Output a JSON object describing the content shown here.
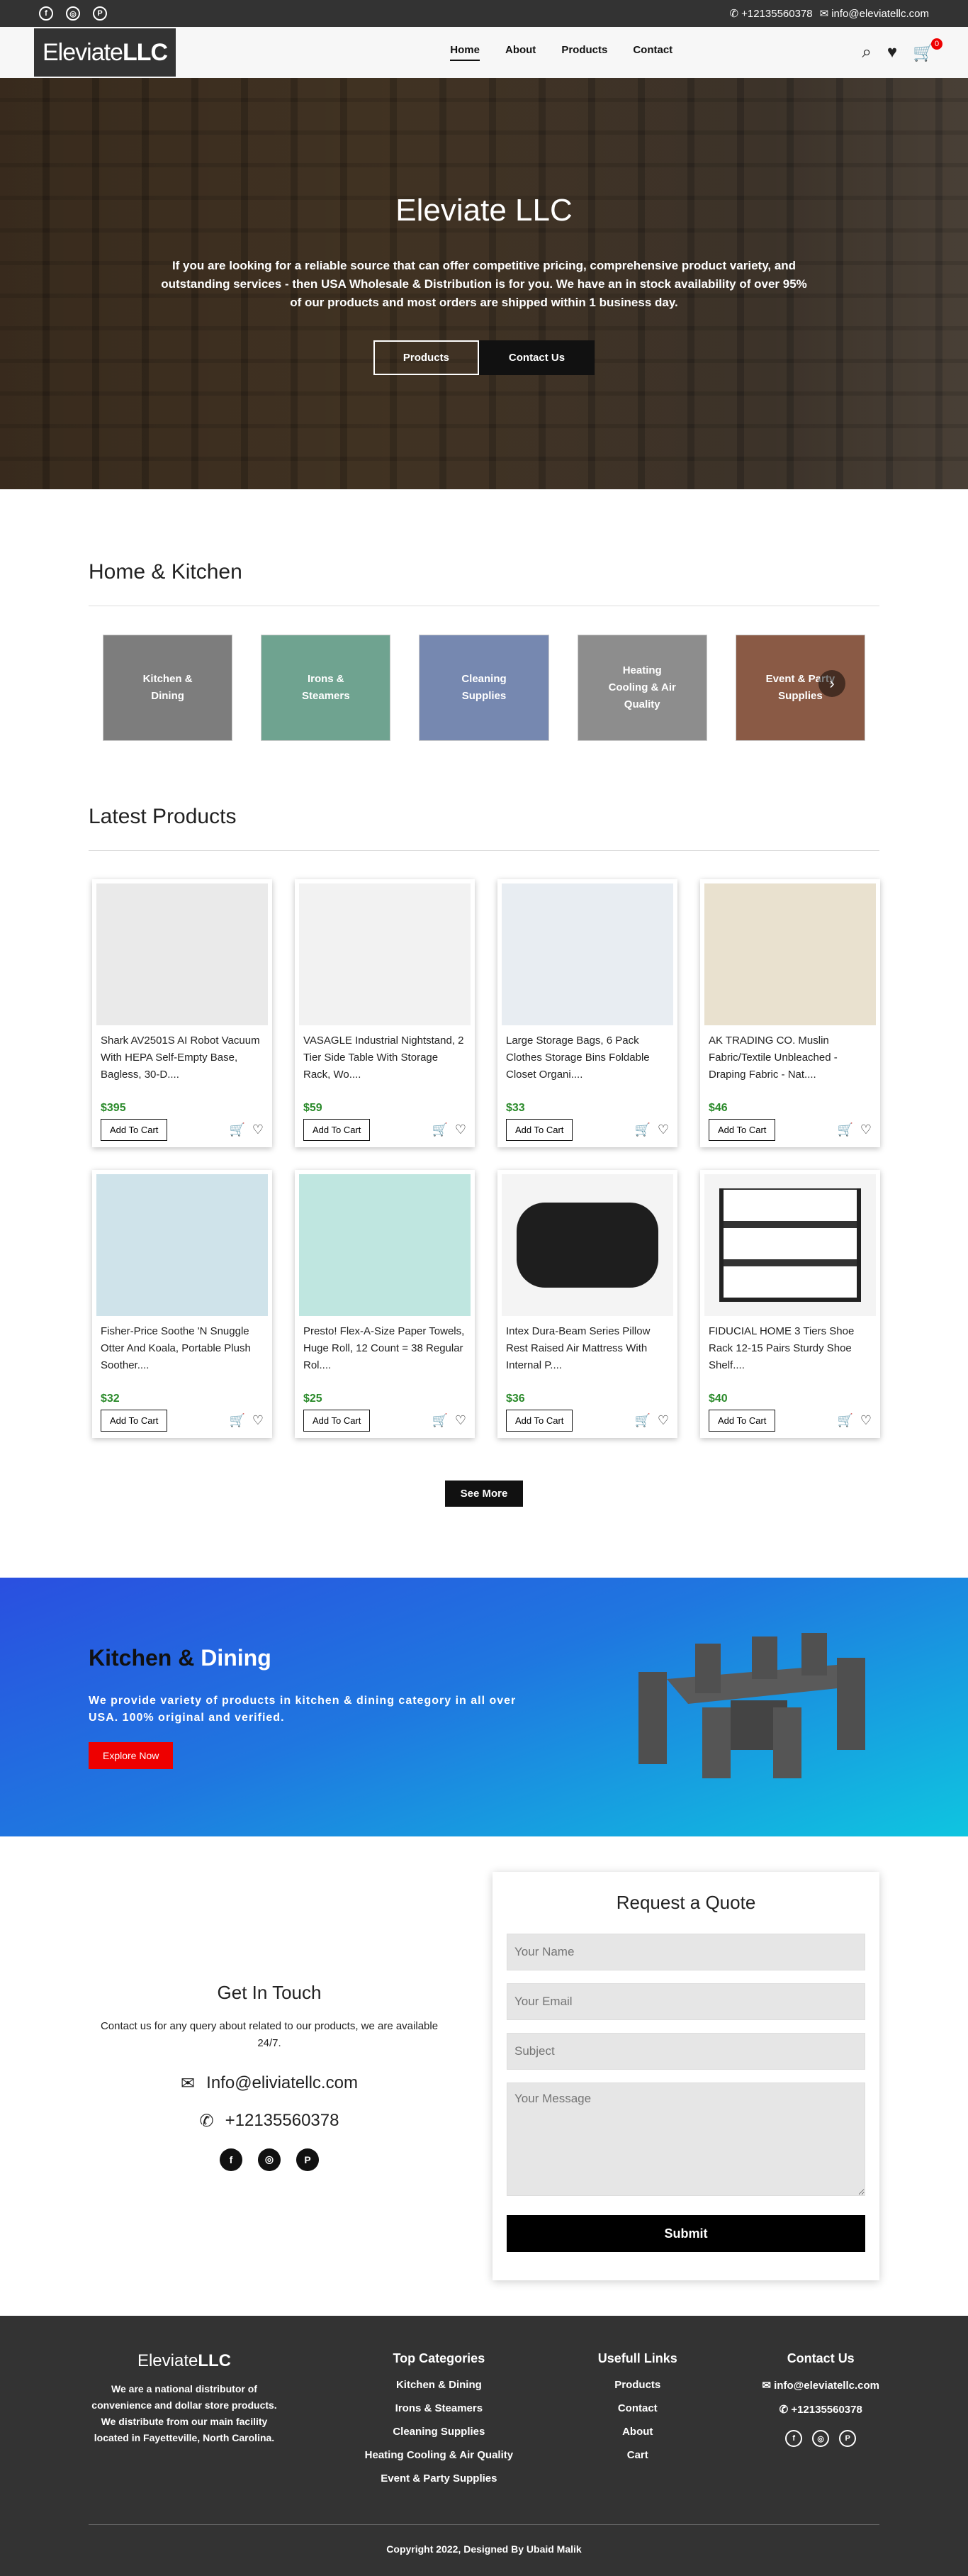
{
  "topbar": {
    "social_icons": [
      "facebook-icon",
      "instagram-icon",
      "pinterest-icon"
    ],
    "phone": "+12135560378",
    "email": "info@eleviatellc.com"
  },
  "nav": {
    "logo_main": "Eleviate",
    "logo_suffix": "LLC",
    "items": [
      "Home",
      "About",
      "Products",
      "Contact"
    ],
    "active": "Home",
    "cart_count": "0"
  },
  "hero": {
    "title": "Eleviate LLC",
    "text": "If you are looking for a reliable source that can offer competitive pricing, comprehensive product variety, and outstanding services - then USA Wholesale & Distribution is for you. We have an in stock availability of over 95% of our products and most orders are shipped within 1 business day.",
    "btn_products": "Products",
    "btn_contact": "Contact Us"
  },
  "categories": {
    "title": "Home & Kitchen",
    "items": [
      {
        "label": "Kitchen & Dining",
        "color": "#7d7d7d"
      },
      {
        "label": "Irons & Steamers",
        "color": "#6fa390"
      },
      {
        "label": "Cleaning Supplies",
        "color": "#7688b0"
      },
      {
        "label": "Heating Cooling & Air Quality",
        "color": "#8d8d8d"
      },
      {
        "label": "Event & Party Supplies",
        "color": "#8a5a45"
      }
    ]
  },
  "products": {
    "title": "Latest Products",
    "add_label": "Add To Cart",
    "items": [
      {
        "name": "Shark AV2501S AI Robot Vacuum With HEPA Self-Empty Base, Bagless, 30-D....",
        "price": "$395",
        "img": "#eaeaea"
      },
      {
        "name": "VASAGLE Industrial Nightstand, 2 Tier Side Table With Storage Rack, Wo....",
        "price": "$59",
        "img": "#f2f2f2"
      },
      {
        "name": "Large Storage Bags, 6 Pack Clothes Storage Bins Foldable Closet Organi....",
        "price": "$33",
        "img": "#e8edf2"
      },
      {
        "name": "AK TRADING CO. Muslin Fabric/Textile Unbleached - Draping Fabric - Nat....",
        "price": "$46",
        "img": "#e9e1cf"
      },
      {
        "name": "Fisher-Price Soothe 'N Snuggle Otter And Koala, Portable Plush Soother....",
        "price": "$32",
        "img": "#cfe3ea"
      },
      {
        "name": "Presto! Flex-A-Size Paper Towels, Huge Roll, 12 Count = 38 Regular Rol....",
        "price": "$25",
        "img": "#bfe6e0"
      },
      {
        "name": "Intex Dura-Beam Series Pillow Rest Raised Air Mattress With Internal P....",
        "price": "$36",
        "img": "#f4f4f4"
      },
      {
        "name": "FIDUCIAL HOME 3 Tiers Shoe Rack 12-15 Pairs Sturdy Shoe Shelf....",
        "price": "$40",
        "img": "#f4f4f4"
      }
    ],
    "see_more": "See More"
  },
  "promo": {
    "title_a": "Kitchen & ",
    "title_b": "Dining",
    "text": "We provide variety of products in kitchen & dining category in all over USA. 100% original and verified.",
    "button": "Explore Now"
  },
  "contact": {
    "title": "Get In Touch",
    "text": "Contact us for any query about related to our products, we are available 24/7.",
    "email": "Info@eliviatellc.com",
    "phone": "+12135560378"
  },
  "quote": {
    "title": "Request a Quote",
    "name_ph": "Your Name",
    "email_ph": "Your Email",
    "subject_ph": "Subject",
    "message_ph": "Your Message",
    "submit": "Submit"
  },
  "footer": {
    "logo_main": "Eleviate",
    "logo_suffix": "LLC",
    "desc": "We are a national distributor of convenience and dollar store products. We distribute from our main facility located in Fayetteville, North Carolina.",
    "cat_title": "Top Categories",
    "categories": [
      "Kitchen & Dining",
      "Irons & Steamers",
      "Cleaning Supplies",
      "Heating Cooling & Air Quality",
      "Event & Party Supplies"
    ],
    "links_title": "Usefull Links",
    "links": [
      "Products",
      "Contact",
      "About",
      "Cart"
    ],
    "contact_title": "Contact Us",
    "email": "info@eleviatellc.com",
    "phone": "+12135560378",
    "copyright": "Copyright 2022, Designed By Ubaid Malik"
  }
}
